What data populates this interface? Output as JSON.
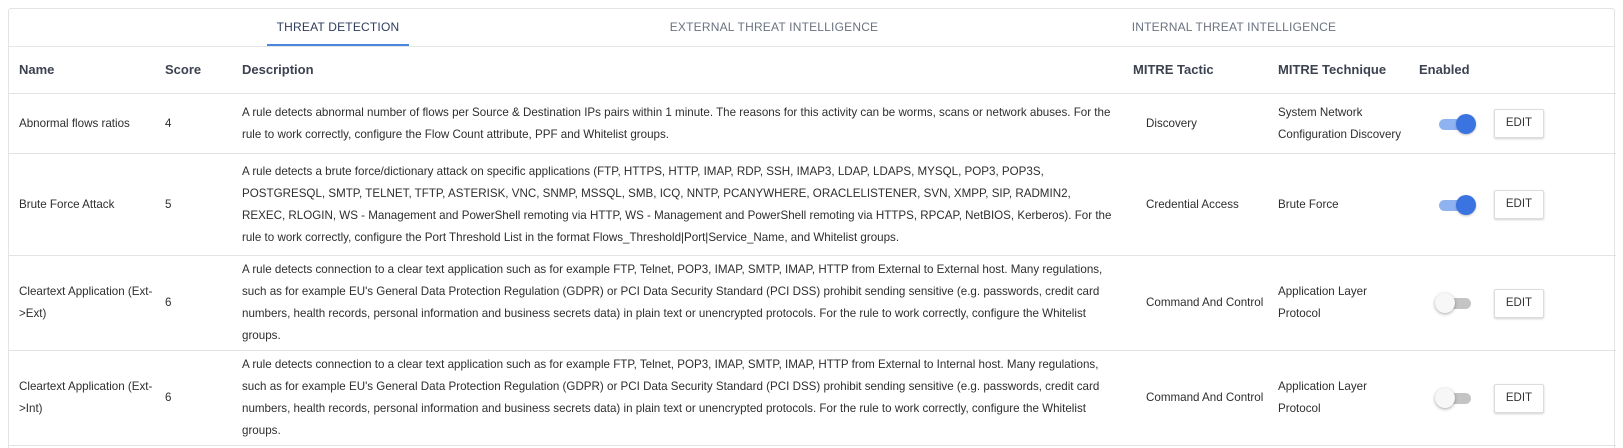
{
  "tabs": [
    {
      "label": "THREAT DETECTION",
      "active": true
    },
    {
      "label": "EXTERNAL THREAT INTELLIGENCE",
      "active": false
    },
    {
      "label": "INTERNAL THREAT INTELLIGENCE",
      "active": false
    }
  ],
  "table": {
    "columns": {
      "name": "Name",
      "score": "Score",
      "description": "Description",
      "tactic": "MITRE Tactic",
      "technique": "MITRE Technique",
      "enabled": "Enabled"
    },
    "edit_label": "EDIT",
    "rows": [
      {
        "name": "Abnormal flows ratios",
        "score": "4",
        "description": "A rule detects abnormal number of flows per Source & Destination IPs pairs within 1 minute. The reasons for this activity can be worms, scans or network abuses. For the rule to work correctly, configure the Flow Count attribute, PPF and Whitelist groups.",
        "tactic": "Discovery",
        "technique": "System Network Configuration Discovery",
        "enabled": true
      },
      {
        "name": "Brute Force Attack",
        "score": "5",
        "description": "A rule detects a brute force/dictionary attack on specific applications (FTP, HTTPS, HTTP, IMAP, RDP, SSH, IMAP3, LDAP, LDAPS, MYSQL, POP3, POP3S, POSTGRESQL, SMTP, TELNET, TFTP, ASTERISK, VNC, SNMP, MSSQL, SMB, ICQ, NNTP, PCANYWHERE, ORACLELISTENER, SVN, XMPP, SIP, RADMIN2, REXEC, RLOGIN, WS - Management and PowerShell remoting via HTTP, WS - Management and PowerShell remoting via HTTPS, RPCAP, NetBIOS, Kerberos). For the rule to work correctly, configure the Port Threshold List in the format Flows_Threshold|Port|Service_Name, and Whitelist groups.",
        "tactic": "Credential Access",
        "technique": "Brute Force",
        "enabled": true
      },
      {
        "name": "Cleartext Application (Ext->Ext)",
        "score": "6",
        "description": "A rule detects connection to a clear text application such as for example FTP, Telnet, POP3, IMAP, SMTP, IMAP, HTTP from External to External host. Many regulations, such as for example EU's General Data Protection Regulation (GDPR) or PCI Data Security Standard (PCI DSS) prohibit sending sensitive (e.g. passwords, credit card numbers, health records, personal information and business secrets data) in plain text or unencrypted protocols. For the rule to work correctly, configure the Whitelist groups.",
        "tactic": "Command And Control",
        "technique": "Application Layer Protocol",
        "enabled": false
      },
      {
        "name": "Cleartext Application (Ext->Int)",
        "score": "6",
        "description": "A rule detects connection to a clear text application such as for example FTP, Telnet, POP3, IMAP, SMTP, IMAP, HTTP from External to Internal host. Many regulations, such as for example EU's General Data Protection Regulation (GDPR) or PCI Data Security Standard (PCI DSS) prohibit sending sensitive (e.g. passwords, credit card numbers, health records, personal information and business secrets data) in plain text or unencrypted protocols. For the rule to work correctly, configure the Whitelist groups.",
        "tactic": "Command And Control",
        "technique": "Application Layer Protocol",
        "enabled": false
      }
    ]
  },
  "colors": {
    "accent": "#3b73e0",
    "toggle_track_on": "#8fb3f0",
    "toggle_off": "#c4c4c4"
  }
}
